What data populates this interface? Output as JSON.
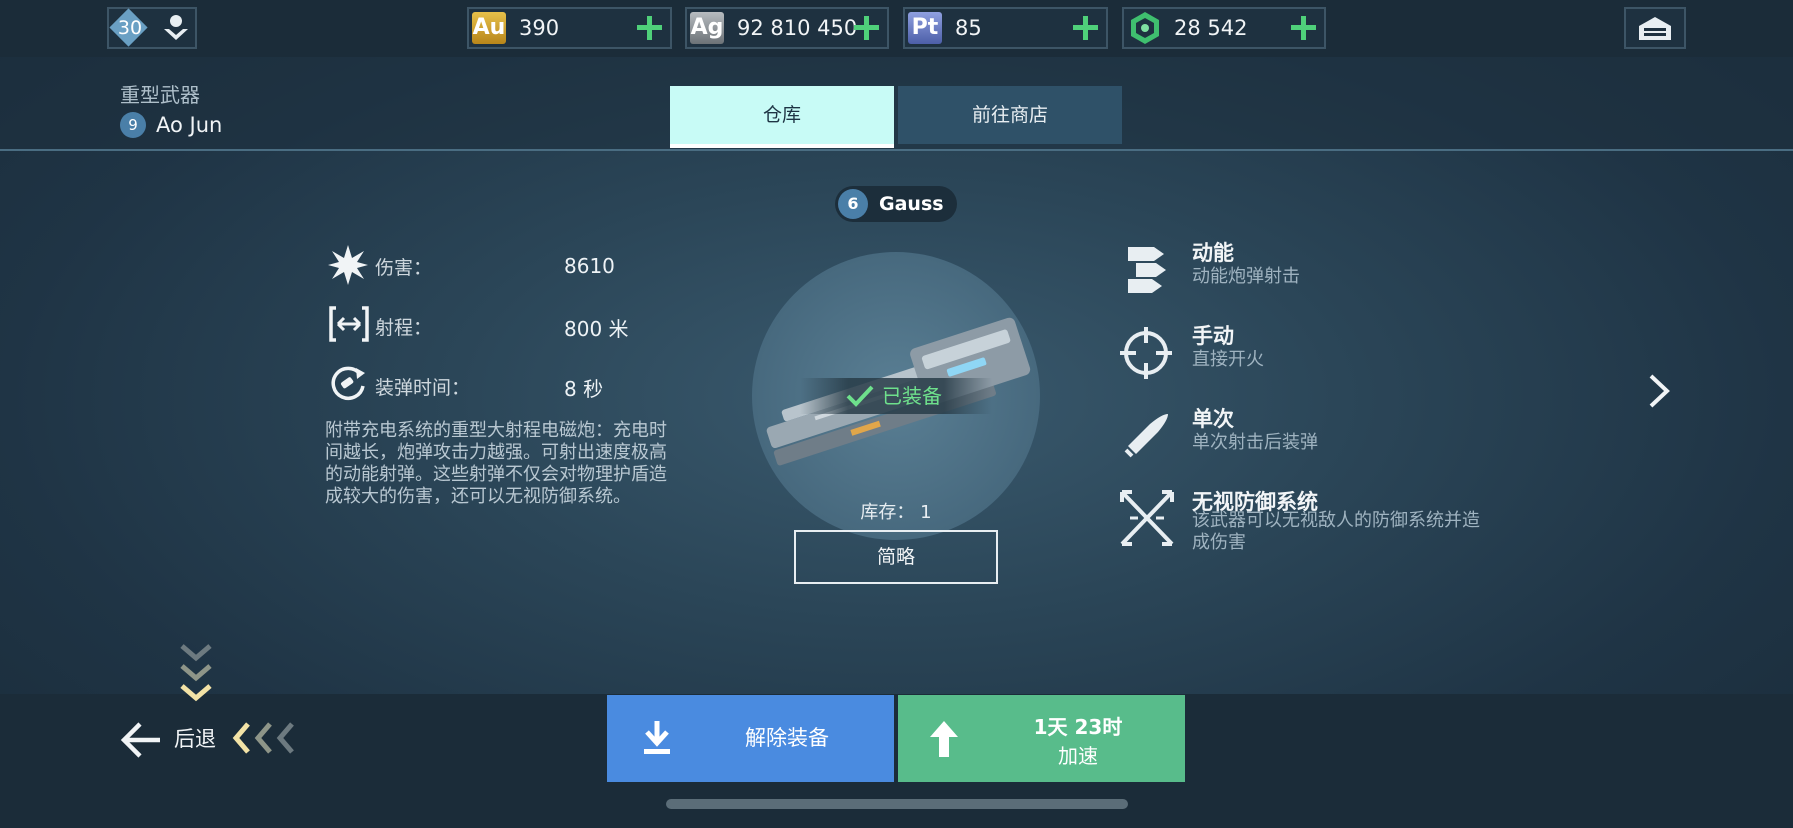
{
  "topbar": {
    "level": "30",
    "resources": [
      {
        "icon_label": "Au",
        "value": "390",
        "color": "#d6a92a"
      },
      {
        "icon_label": "Ag",
        "value": "92 810 450",
        "color": "#8e9397"
      },
      {
        "icon_label": "Pt",
        "value": "85",
        "color": "#6c7fc2"
      },
      {
        "icon_label": "",
        "value": "28 542",
        "color": "#3fbf6f"
      }
    ]
  },
  "header": {
    "category": "重型武器",
    "pilot_level": "9",
    "pilot_name": "Ao Jun"
  },
  "tabs": [
    {
      "label": "仓库",
      "active": true
    },
    {
      "label": "前往商店",
      "active": false
    }
  ],
  "weapon": {
    "level": "6",
    "name": "Gauss",
    "equipped_label": "已装备",
    "stock_label": "库存： 1",
    "summary_button": "简略"
  },
  "stats": [
    {
      "label": "伤害：",
      "value": "8610",
      "icon": "burst-icon"
    },
    {
      "label": "射程：",
      "value": "800 米",
      "icon": "range-icon"
    },
    {
      "label": "装弹时间：",
      "value": "8 秒",
      "icon": "reload-icon"
    }
  ],
  "description": "附带充电系统的重型大射程电磁炮：充电时间越长，炮弹攻击力越强。可射出速度极高的动能射弹。这些射弹不仅会对物理护盾造成较大的伤害，还可以无视防御系统。",
  "features": [
    {
      "title": "动能",
      "desc": "动能炮弹射击",
      "icon": "kinetic-icon"
    },
    {
      "title": "手动",
      "desc": "直接开火",
      "icon": "crosshair-icon"
    },
    {
      "title": "单次",
      "desc": "单次射击后装弹",
      "icon": "single-shot-icon"
    },
    {
      "title": "无视防御系统",
      "desc": "该武器可以无视敌人的防御系统并造成伤害",
      "icon": "ignore-defense-icon"
    }
  ],
  "bottom": {
    "back_label": "后退",
    "unequip_label": "解除装备",
    "speedup_time": "1天 23时",
    "speedup_label": "加速"
  },
  "colors": {
    "unequip": "#4a8be0",
    "speedup": "#58bc8b",
    "tab_active": "#c8fbf6",
    "tab_inactive": "#2f5168"
  }
}
